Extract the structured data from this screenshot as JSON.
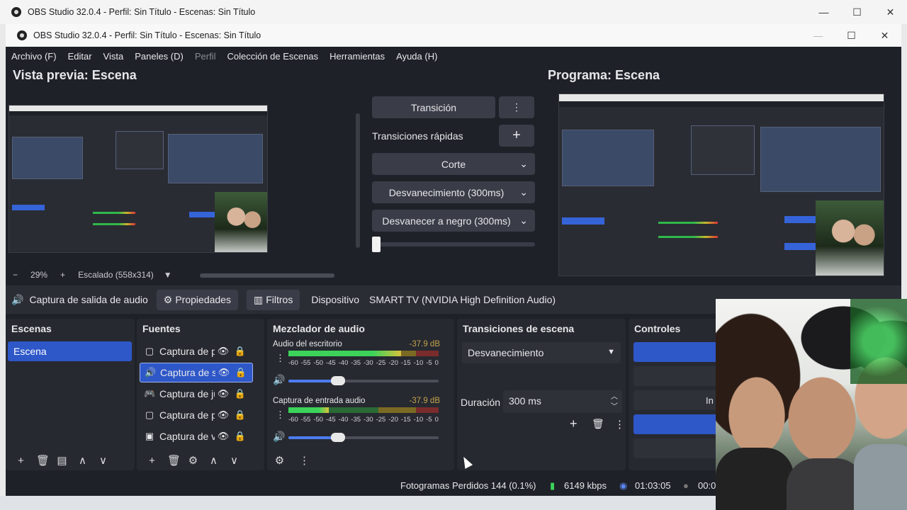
{
  "outer_window": {
    "title": "OBS Studio 32.0.4 - Perfil: Sin Título - Escenas: Sin Título"
  },
  "inner_window": {
    "title": "OBS Studio 32.0.4 - Perfil: Sin Título - Escenas: Sin Título"
  },
  "window_controls": {
    "minimize": "—",
    "maximize": "☐",
    "close": "✕"
  },
  "menu": [
    "Archivo (F)",
    "Editar",
    "Vista",
    "Paneles (D)",
    "Perfil",
    "Colección de Escenas",
    "Herramientas",
    "Ayuda (H)"
  ],
  "preview": {
    "title": "Vista previa: Escena",
    "zoom_minus": "−",
    "zoom_value": "29%",
    "zoom_plus": "+",
    "scale_label": "Escalado (558x314)",
    "scale_arrow": "▼"
  },
  "program": {
    "title": "Programa: Escena"
  },
  "transitions_panel": {
    "transition_button": "Transición",
    "kebab": "⋮",
    "quick_transitions_label": "Transiciones rápidas",
    "add": "+",
    "quick": [
      {
        "label": "Corte",
        "arrow": "⌄"
      },
      {
        "label": "Desvanecimiento (300ms)",
        "arrow": "⌄"
      },
      {
        "label": "Desvanecer a negro (300ms)",
        "arrow": "⌄"
      }
    ],
    "tbar_value": 0
  },
  "source_toolbar": {
    "speaker_icon": "🔊",
    "source_name": "Captura de salida de audio",
    "properties_icon": "⚙",
    "properties": "Propiedades",
    "filters_icon": "▥",
    "filters": "Filtros",
    "device_label": "Dispositivo",
    "device_value": "SMART TV (NVIDIA High Definition Audio)"
  },
  "scenes": {
    "title": "Escenas",
    "items": [
      "Escena"
    ],
    "footer": {
      "add": "+",
      "remove": "🗑",
      "filters": "▤",
      "up": "∧",
      "down": "∨"
    }
  },
  "sources": {
    "title": "Fuentes",
    "items": [
      {
        "icon": "▢",
        "name": "Captura de p",
        "eye": "👁",
        "lock": "🔒"
      },
      {
        "icon": "🔊",
        "name": "Captura de s",
        "eye": "👁",
        "lock": "🔒"
      },
      {
        "icon": "🎮",
        "name": "Captura de ju",
        "eye": "👁",
        "lock": "🔒"
      },
      {
        "icon": "▢",
        "name": "Captura de p",
        "eye": "👁",
        "lock": "🔒"
      },
      {
        "icon": "▣",
        "name": "Captura de v",
        "eye": "👁",
        "lock": "🔒"
      }
    ],
    "footer": {
      "add": "+",
      "remove": "🗑",
      "settings": "⚙",
      "up": "∧",
      "down": "∨"
    }
  },
  "mixer": {
    "title": "Mezclador de audio",
    "channels": [
      {
        "name": "Audio del escritorio",
        "db": "-37.9 dB",
        "level": 0.75,
        "volume": 0.33,
        "kebab": "⋮",
        "speaker": "🔊"
      },
      {
        "name": "Captura de entrada audio",
        "db": "-37.9 dB",
        "level": 0.27,
        "volume": 0.33,
        "kebab": "⋮",
        "speaker": "🔊"
      }
    ],
    "scale": [
      "-60",
      "-55",
      "-50",
      "-45",
      "-40",
      "-35",
      "-30",
      "-25",
      "-20",
      "-15",
      "-10",
      "-5",
      "0"
    ],
    "footer": {
      "settings": "⚙",
      "menu": "⋮"
    }
  },
  "scene_transitions": {
    "title": "Transiciones de escena",
    "selected": "Desvanecimiento",
    "arrow": "▼",
    "duration_label": "Duración",
    "duration_value": "300 ms",
    "spin_up": "︿",
    "spin_down": "﹀",
    "add": "+",
    "remove": "🗑",
    "menu": "⋮"
  },
  "controls": {
    "title": "Controles",
    "partial_label": "In"
  },
  "status": {
    "dropped_frames": "Fotogramas Perdidos 144 (0.1%)",
    "bitrate": "6149 kbps",
    "stream_time": "01:03:05",
    "rec_time": "00:0"
  },
  "colors": {
    "accent": "#2e57c8",
    "bg": "#1f2128",
    "dock": "#272930",
    "button": "#3a3d48"
  }
}
